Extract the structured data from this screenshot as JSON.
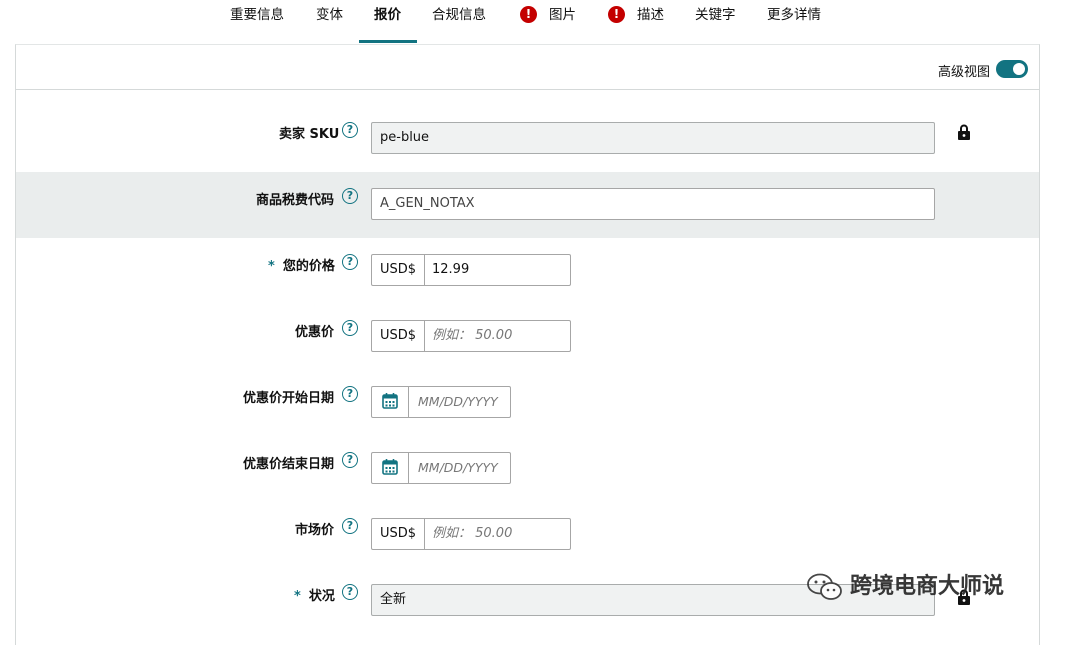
{
  "tabs": [
    {
      "label": "重要信息"
    },
    {
      "label": "变体"
    },
    {
      "label": "报价"
    },
    {
      "label": "合规信息"
    },
    {
      "label": "图片",
      "error_icon": "exclamation-circle-icon"
    },
    {
      "label": "描述",
      "error_icon": "exclamation-circle-icon"
    },
    {
      "label": "关键字"
    },
    {
      "label": "更多详情"
    }
  ],
  "active_tab": "报价",
  "error_mark": "!",
  "help_mark": "?",
  "advanced_view": {
    "label": "高级视图",
    "enabled": true
  },
  "fields": {
    "seller_sku": {
      "label": "卖家 SKU",
      "value": "pe-blue",
      "locked": true
    },
    "tax_code": {
      "label": "商品税费代码",
      "value": "A_GEN_NOTAX"
    },
    "your_price": {
      "label": "您的价格",
      "required_mark": "*",
      "currency": "USD$",
      "value": "12.99"
    },
    "sale_price": {
      "label": "优惠价",
      "currency": "USD$",
      "placeholder": "例如： 50.00"
    },
    "sale_start": {
      "label": "优惠价开始日期",
      "placeholder": "MM/DD/YYYY"
    },
    "sale_end": {
      "label": "优惠价结束日期",
      "placeholder": "MM/DD/YYYY"
    },
    "list_price": {
      "label": "市场价",
      "currency": "USD$",
      "placeholder": "例如： 50.00"
    },
    "condition": {
      "label": "状况",
      "required_mark": "*",
      "value": "全新",
      "locked": true
    }
  },
  "watermark": {
    "text": "跨境电商大师说",
    "icon": "wechat-icon"
  },
  "colors": {
    "accent": "#127381",
    "error": "#c40000",
    "shaded_row": "#eaeded"
  }
}
